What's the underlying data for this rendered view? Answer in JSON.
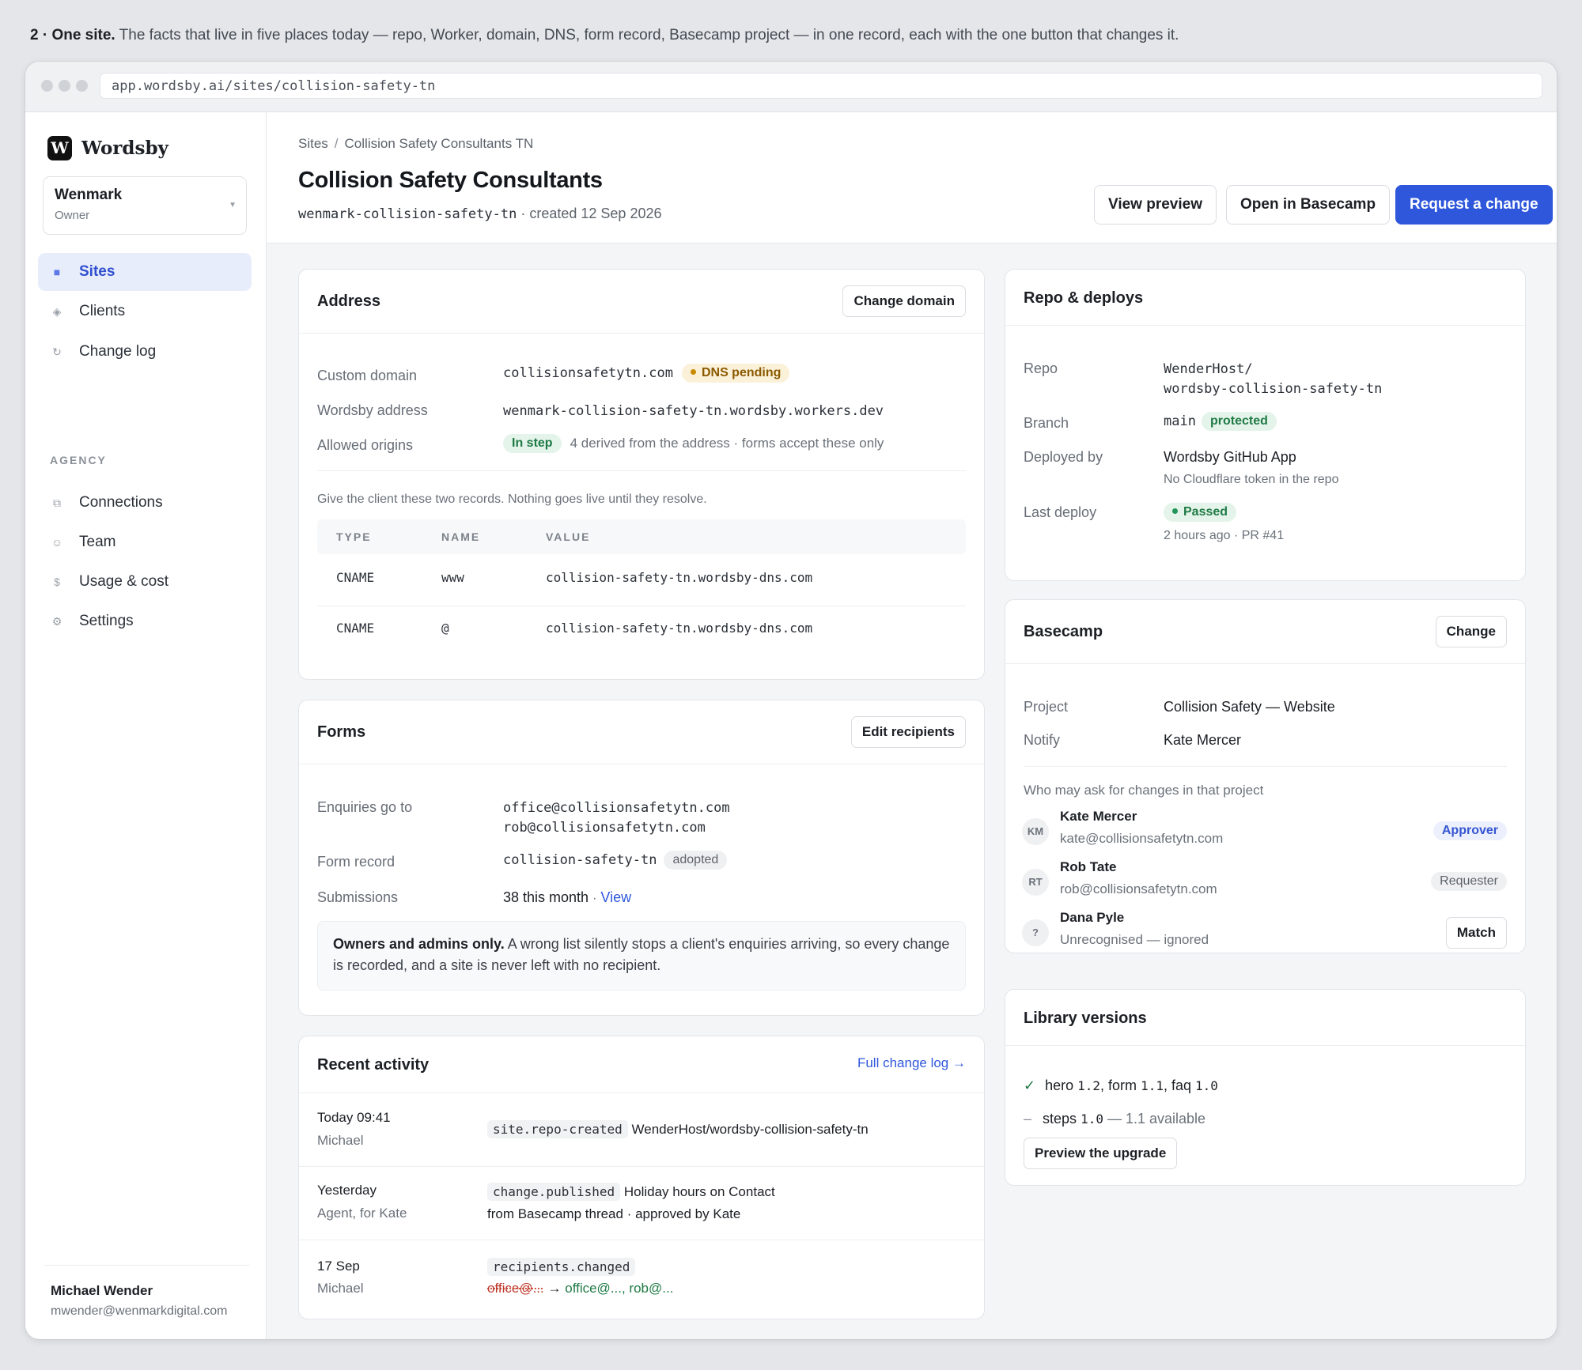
{
  "caption": {
    "number": "2 · One site.",
    "text": "The facts that live in five places today — repo, Worker, domain, DNS, form record, Basecamp project — in one record, each with the one button that changes it."
  },
  "browser": {
    "url": "app.wordsby.ai/sites/collision-safety-tn"
  },
  "sidebar": {
    "brand": "Wordsby",
    "brand_mark": "W",
    "workspace": {
      "name": "Wenmark",
      "role": "Owner"
    },
    "nav": [
      {
        "label": "Sites",
        "icon": "square-icon"
      },
      {
        "label": "Clients",
        "icon": "diamond-icon"
      },
      {
        "label": "Change log",
        "icon": "refresh-icon"
      }
    ],
    "section_label": "AGENCY",
    "agency_nav": [
      {
        "label": "Connections",
        "icon": "plug-icon"
      },
      {
        "label": "Team",
        "icon": "smile-icon"
      },
      {
        "label": "Usage & cost",
        "icon": "dollar-icon"
      },
      {
        "label": "Settings",
        "icon": "gear-icon"
      }
    ],
    "user": {
      "name": "Michael Wender",
      "email": "mwender@wenmarkdigital.com"
    }
  },
  "header": {
    "crumb_root": "Sites",
    "crumb_current": "Collision Safety Consultants TN",
    "title": "Collision Safety Consultants",
    "slug": "wenmark-collision-safety-tn",
    "created": "· created 12 Sep 2026",
    "buttons": {
      "preview": "View preview",
      "basecamp": "Open in Basecamp",
      "request": "Request a change"
    }
  },
  "address": {
    "title": "Address",
    "button": "Change domain",
    "custom_domain_label": "Custom domain",
    "custom_domain": "collisionsafetytn.com",
    "dns_badge": "DNS pending",
    "wordsby_label": "Wordsby address",
    "wordsby_address": "wenmark-collision-safety-tn.wordsby.workers.dev",
    "origins_label": "Allowed origins",
    "origins_badge": "In step",
    "origins_note": "4 derived from the address · forms accept these only",
    "records_note": "Give the client these two records. Nothing goes live until they resolve.",
    "table": {
      "headers": [
        "TYPE",
        "NAME",
        "VALUE"
      ],
      "rows": [
        {
          "type": "CNAME",
          "name": "www",
          "value": "collision-safety-tn.wordsby-dns.com"
        },
        {
          "type": "CNAME",
          "name": "@",
          "value": "collision-safety-tn.wordsby-dns.com"
        }
      ]
    }
  },
  "forms": {
    "title": "Forms",
    "button": "Edit recipients",
    "enquiries_label": "Enquiries go to",
    "recipients": [
      "office@collisionsafetytn.com",
      "rob@collisionsafetytn.com"
    ],
    "record_label": "Form record",
    "record": "collision-safety-tn",
    "record_badge": "adopted",
    "submissions_label": "Submissions",
    "submissions": "38 this month",
    "submissions_sep": "·",
    "submissions_link": "View",
    "note_bold": "Owners and admins only.",
    "note_text": "A wrong list silently stops a client's enquiries arriving, so every change is recorded, and a site is never left with no recipient."
  },
  "activity": {
    "title": "Recent activity",
    "link": "Full change log →",
    "rows": [
      {
        "when": "Today 09:41",
        "who": "Michael",
        "event": "site.repo-created",
        "text": "WenderHost/wordsby-collision-safety-tn",
        "sub": ""
      },
      {
        "when": "Yesterday",
        "who": "Agent, for Kate",
        "event": "change.published",
        "text": "Holiday hours on Contact",
        "sub": "from Basecamp thread · approved by Kate"
      },
      {
        "when": "17 Sep",
        "who": "Michael",
        "event": "recipients.changed",
        "old": "office@...",
        "arrow": "→",
        "new": "office@..., rob@..."
      }
    ]
  },
  "repo": {
    "title": "Repo & deploys",
    "repo_label": "Repo",
    "repo_line1": "WenderHost/",
    "repo_line2": "wordsby-collision-safety-tn",
    "branch_label": "Branch",
    "branch": "main",
    "branch_badge": "protected",
    "deployed_label": "Deployed by",
    "deployed_by": "Wordsby GitHub App",
    "deployed_note": "No Cloudflare token in the repo",
    "last_label": "Last deploy",
    "last_badge": "Passed",
    "last_note": "2 hours ago · PR #41"
  },
  "basecamp": {
    "title": "Basecamp",
    "button": "Change",
    "project_label": "Project",
    "project": "Collision Safety — Website",
    "notify_label": "Notify",
    "notify": "Kate Mercer",
    "who_label": "Who may ask for changes in that project",
    "people": [
      {
        "initials": "KM",
        "name": "Kate Mercer",
        "detail": "kate@collisionsafetytn.com",
        "role": "Approver"
      },
      {
        "initials": "RT",
        "name": "Rob Tate",
        "detail": "rob@collisionsafetytn.com",
        "role": "Requester"
      },
      {
        "initials": "?",
        "name": "Dana Pyle",
        "detail": "Unrecognised — ignored",
        "action": "Match"
      }
    ]
  },
  "library": {
    "title": "Library versions",
    "line1_prefix": "hero",
    "line1_v1": "1.2",
    "line1_mid1": ", form",
    "line1_v2": "1.1",
    "line1_mid2": ", faq",
    "line1_v3": "1.0",
    "line2_prefix": "steps",
    "line2_v": "1.0",
    "line2_suffix": "— 1.1 available",
    "button": "Preview the upgrade"
  }
}
